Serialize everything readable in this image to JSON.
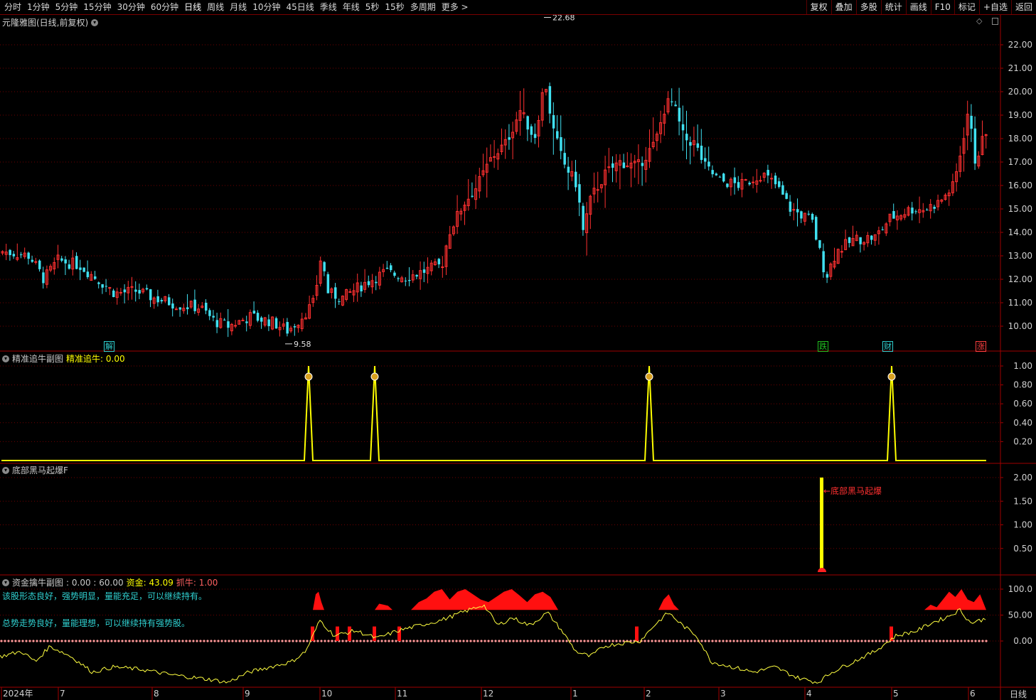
{
  "toolbar": {
    "periods": [
      "分时",
      "1分钟",
      "5分钟",
      "15分钟",
      "30分钟",
      "60分钟",
      "日线",
      "周线",
      "月线",
      "10分钟",
      "45日线",
      "季线",
      "年线",
      "5秒",
      "15秒",
      "多周期",
      "更多 >"
    ],
    "active": "日线",
    "tools": [
      "复权",
      "叠加",
      "多股",
      "统计",
      "画线",
      "F10",
      "标记",
      "+自选",
      "返回"
    ]
  },
  "main": {
    "title": "元隆雅图(日线,前复权)",
    "high_label": "22.68",
    "low_label": "9.58",
    "y_ticks": [
      "22.00",
      "21.00",
      "20.00",
      "19.00",
      "18.00",
      "17.00",
      "16.00",
      "15.00",
      "14.00",
      "13.00",
      "12.00",
      "11.00",
      "10.00"
    ],
    "badges": [
      {
        "text": "解",
        "color": "#2fd0d0",
        "x": 146
      },
      {
        "text": "跌",
        "color": "#20c020",
        "x": 1150
      },
      {
        "text": "财",
        "color": "#2fd0d0",
        "x": 1241
      },
      {
        "text": "涨",
        "color": "#ff4040",
        "x": 1372
      }
    ]
  },
  "panel1": {
    "title": "精准追牛副图",
    "value_label": "精准追牛: 0.00",
    "y_ticks": [
      "1.00",
      "0.80",
      "0.60",
      "0.40",
      "0.20"
    ]
  },
  "panel2": {
    "title": "底部黑马起爆F",
    "signal_label": "←底部黑马起爆",
    "y_ticks": [
      "2.00",
      "1.50",
      "1.00",
      "0.50"
    ]
  },
  "panel3": {
    "title": "资金擒牛副图",
    "values": ": 0.00 : 60.00",
    "fund_label": "资金: 43.09",
    "catch_label": "抓牛: 1.00",
    "msg1": "该股形态良好，强势明显，量能充足，可以继续持有。",
    "msg2": "总势走势良好，量能理想，可以继续持有强势股。",
    "y_ticks": [
      "100.0",
      "50.00",
      "0.00"
    ]
  },
  "xaxis": {
    "labels": [
      "2024年",
      "7",
      "8",
      "9",
      "10",
      "11",
      "12",
      "1",
      "2",
      "3",
      "4",
      "5",
      "6"
    ],
    "period_label": "日线"
  },
  "colors": {
    "up": "#ff3030",
    "down": "#40e0f0",
    "grid": "#700000",
    "axis": "#a00000",
    "yellow": "#ffff00"
  }
}
